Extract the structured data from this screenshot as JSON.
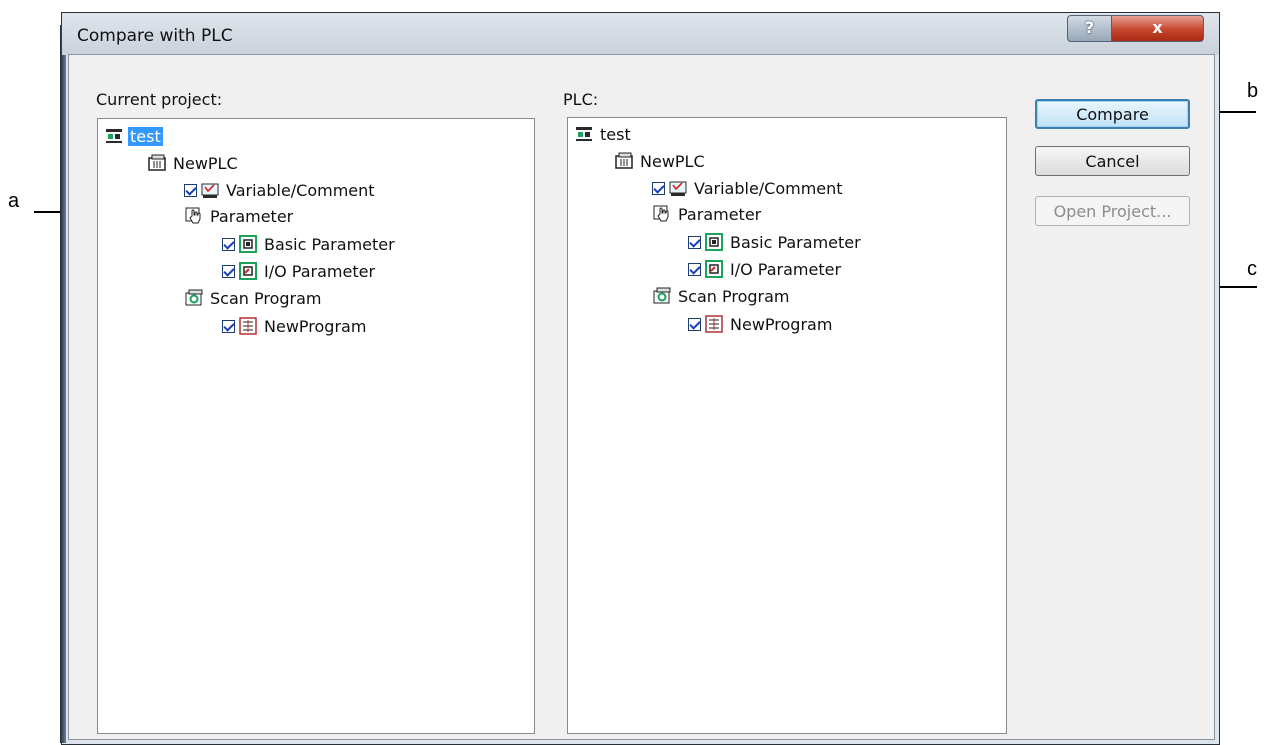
{
  "window": {
    "title": "Compare with PLC",
    "help_glyph": "?",
    "close_glyph": "x"
  },
  "left_panel": {
    "label": "Current project:",
    "tree": [
      {
        "label": "test",
        "icon": "project-icon",
        "checked": null,
        "selected": true
      },
      {
        "label": "NewPLC",
        "icon": "plc-icon",
        "checked": null
      },
      {
        "label": "Variable/Comment",
        "icon": "variable-comment-icon",
        "checked": true
      },
      {
        "label": "Parameter",
        "icon": "parameter-icon",
        "checked": null
      },
      {
        "label": "Basic Parameter",
        "icon": "basic-parameter-icon",
        "checked": true
      },
      {
        "label": "I/O Parameter",
        "icon": "io-parameter-icon",
        "checked": true
      },
      {
        "label": "Scan Program",
        "icon": "scan-program-icon",
        "checked": null
      },
      {
        "label": "NewProgram",
        "icon": "program-icon",
        "checked": true
      }
    ]
  },
  "right_panel": {
    "label": "PLC:",
    "tree": [
      {
        "label": "test",
        "icon": "project-icon",
        "checked": null,
        "selected": false
      },
      {
        "label": "NewPLC",
        "icon": "plc-icon",
        "checked": null
      },
      {
        "label": "Variable/Comment",
        "icon": "variable-comment-icon",
        "checked": true
      },
      {
        "label": "Parameter",
        "icon": "parameter-icon",
        "checked": null
      },
      {
        "label": "Basic Parameter",
        "icon": "basic-parameter-icon",
        "checked": true
      },
      {
        "label": "I/O Parameter",
        "icon": "io-parameter-icon",
        "checked": true
      },
      {
        "label": "Scan Program",
        "icon": "scan-program-icon",
        "checked": null
      },
      {
        "label": "NewProgram",
        "icon": "program-icon",
        "checked": true
      }
    ]
  },
  "buttons": {
    "compare": "Compare",
    "cancel": "Cancel",
    "open_project": "Open Project..."
  },
  "callouts": {
    "a": "a",
    "b": "b",
    "c": "c"
  },
  "colors": {
    "selection": "#3399ff",
    "close_button": "#c4452d",
    "dialog_face": "#f0f0f0"
  }
}
